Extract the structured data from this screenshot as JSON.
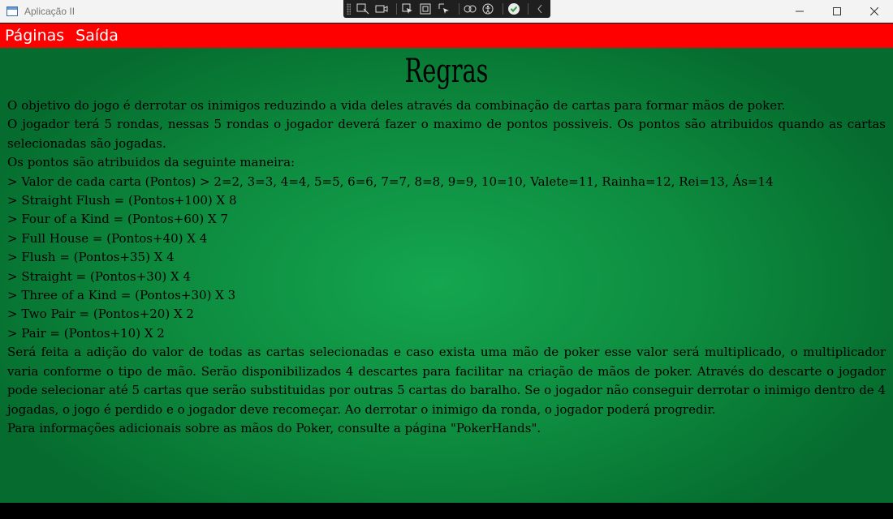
{
  "window": {
    "title": "Aplicação II",
    "icon": "app-window-icon"
  },
  "menu": {
    "items": [
      "Páginas",
      "Saída"
    ],
    "background": "#ff0000"
  },
  "content": {
    "heading": "Regras",
    "intro": [
      "O objetivo do jogo é derrotar os inimigos reduzindo a vida deles através da combinação de cartas para formar mãos de poker.",
      "O jogador terá 5 rondas, nessas 5 rondas o jogador deverá fazer o maximo de pontos possiveis. Os pontos são atribuidos quando as cartas selecionadas são jogadas.",
      "Os pontos são atribuidos da seguinte maneira:"
    ],
    "rules": [
      "> Valor de cada carta (Pontos) > 2=2, 3=3, 4=4, 5=5, 6=6, 7=7, 8=8, 9=9, 10=10, Valete=11, Rainha=12, Rei=13, Ás=14",
      "> Straight Flush = (Pontos+100) X 8",
      "> Four of a Kind = (Pontos+60) X 7",
      "> Full House = (Pontos+40) X 4",
      "> Flush = (Pontos+35) X 4",
      "> Straight = (Pontos+30) X 4",
      "> Three of a Kind = (Pontos+30) X 3",
      "> Two Pair = (Pontos+20) X 2",
      "> Pair = (Pontos+10) X 2"
    ],
    "explanation": "Será feita a adição do valor de todas as cartas selecionadas e caso exista uma mão de poker esse valor será multiplicado, o multiplicador varia conforme o tipo de mão.  Serão disponibilizados 4 descartes para facilitar na criação de mãos de poker. Através do descarte o jogador pode selecionar até 5 cartas que serão substituidas por outras 5 cartas do baralho. Se o jogador não conseguir derrotar o inimigo dentro de 4 jogadas, o jogo é perdido e o jogador deve recomeçar. Ao derrotar o inimigo da ronda, o jogador poderá progredir.",
    "footer": "Para informações adicionais sobre as mãos do Poker, consulte a página \"PokerHands\"."
  },
  "colors": {
    "menu_bar": "#ff0000",
    "background_center": "#14a650",
    "background_edge": "#056b2e"
  }
}
